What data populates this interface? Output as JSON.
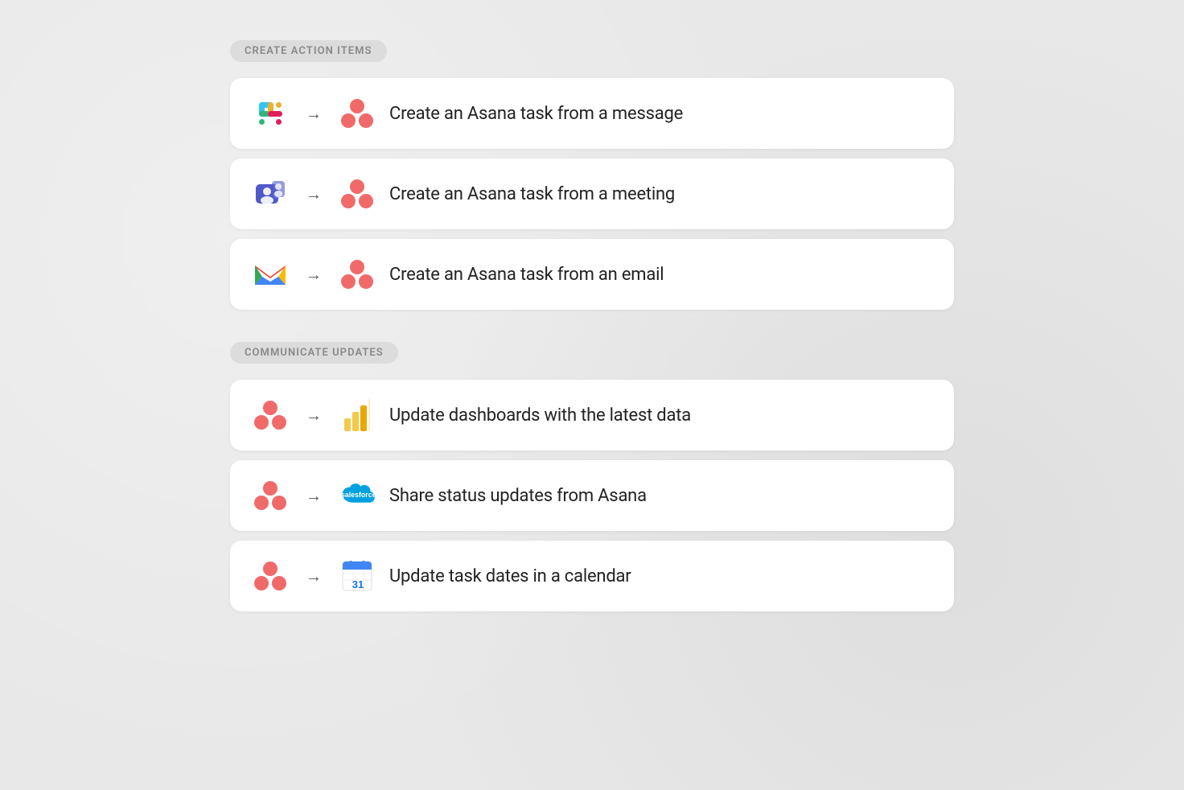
{
  "sections": [
    {
      "id": "create-action-items",
      "label": "CREATE ACTION ITEMS",
      "cards": [
        {
          "id": "slack-to-asana",
          "text": "Create an Asana task from a message",
          "from_icon": "slack",
          "to_icon": "asana"
        },
        {
          "id": "teams-to-asana",
          "text": "Create an Asana task from a meeting",
          "from_icon": "teams",
          "to_icon": "asana"
        },
        {
          "id": "gmail-to-asana",
          "text": "Create an Asana task from an email",
          "from_icon": "gmail",
          "to_icon": "asana"
        }
      ]
    },
    {
      "id": "communicate-updates",
      "label": "COMMUNICATE UPDATES",
      "cards": [
        {
          "id": "asana-to-powerbi",
          "text": "Update dashboards with the latest data",
          "from_icon": "asana",
          "to_icon": "powerbi"
        },
        {
          "id": "asana-to-salesforce",
          "text": "Share status updates from Asana",
          "from_icon": "asana",
          "to_icon": "salesforce"
        },
        {
          "id": "asana-to-gcal",
          "text": "Update task dates in a calendar",
          "from_icon": "asana",
          "to_icon": "gcal"
        }
      ]
    }
  ],
  "arrow": "→"
}
